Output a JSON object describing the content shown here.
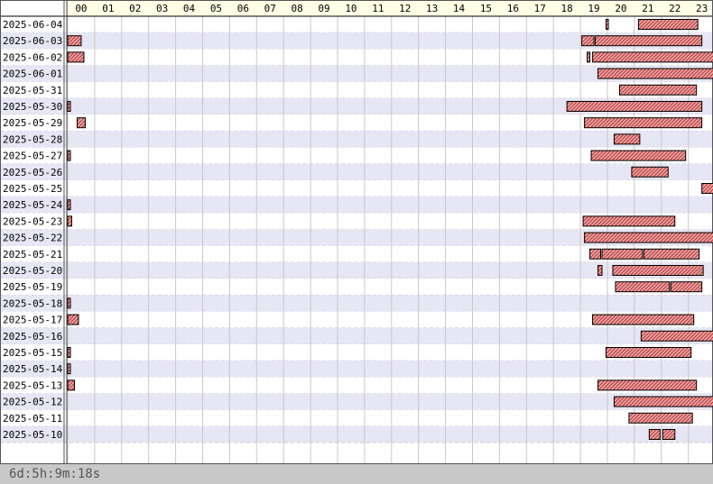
{
  "chart_data": {
    "type": "gantt",
    "x_axis": {
      "unit": "hour",
      "ticks": [
        "00",
        "01",
        "02",
        "03",
        "04",
        "05",
        "06",
        "07",
        "08",
        "09",
        "10",
        "11",
        "12",
        "13",
        "14",
        "15",
        "16",
        "17",
        "18",
        "19",
        "20",
        "21",
        "22",
        "23"
      ],
      "range": [
        0,
        24
      ]
    },
    "rows": [
      {
        "date": "2025-06-04",
        "intervals": [
          [
            19.95,
            20.0
          ],
          [
            21.15,
            23.35
          ]
        ]
      },
      {
        "date": "2025-06-03",
        "intervals": [
          [
            0.0,
            0.5
          ],
          [
            19.05,
            19.5
          ],
          [
            19.55,
            23.5
          ]
        ]
      },
      {
        "date": "2025-06-02",
        "intervals": [
          [
            0.0,
            0.6
          ],
          [
            19.25,
            19.35
          ],
          [
            19.45,
            23.95
          ]
        ]
      },
      {
        "date": "2025-06-01",
        "intervals": [
          [
            19.65,
            23.95
          ]
        ]
      },
      {
        "date": "2025-05-31",
        "intervals": [
          [
            20.45,
            23.3
          ]
        ]
      },
      {
        "date": "2025-05-30",
        "intervals": [
          [
            0.0,
            0.1
          ],
          [
            18.5,
            23.5
          ]
        ]
      },
      {
        "date": "2025-05-29",
        "intervals": [
          [
            0.35,
            0.65
          ],
          [
            19.15,
            23.5
          ]
        ]
      },
      {
        "date": "2025-05-28",
        "intervals": [
          [
            20.25,
            21.2
          ]
        ]
      },
      {
        "date": "2025-05-27",
        "intervals": [
          [
            0.0,
            0.1
          ],
          [
            19.4,
            22.9
          ]
        ]
      },
      {
        "date": "2025-05-26",
        "intervals": [
          [
            20.9,
            22.25
          ]
        ]
      },
      {
        "date": "2025-05-25",
        "intervals": [
          [
            23.5,
            23.95
          ]
        ]
      },
      {
        "date": "2025-05-24",
        "intervals": [
          [
            0.0,
            0.1
          ]
        ]
      },
      {
        "date": "2025-05-23",
        "intervals": [
          [
            0.0,
            0.15
          ],
          [
            19.1,
            22.5
          ]
        ]
      },
      {
        "date": "2025-05-22",
        "intervals": [
          [
            19.15,
            23.95
          ]
        ]
      },
      {
        "date": "2025-05-21",
        "intervals": [
          [
            19.35,
            19.75
          ],
          [
            19.8,
            21.3
          ],
          [
            21.35,
            23.4
          ]
        ]
      },
      {
        "date": "2025-05-20",
        "intervals": [
          [
            19.65,
            19.8
          ],
          [
            20.2,
            23.55
          ]
        ]
      },
      {
        "date": "2025-05-19",
        "intervals": [
          [
            20.3,
            22.3
          ],
          [
            22.35,
            23.5
          ]
        ]
      },
      {
        "date": "2025-05-18",
        "intervals": [
          [
            0.0,
            0.1
          ]
        ]
      },
      {
        "date": "2025-05-17",
        "intervals": [
          [
            0.0,
            0.4
          ],
          [
            19.45,
            23.2
          ]
        ]
      },
      {
        "date": "2025-05-16",
        "intervals": [
          [
            21.25,
            23.95
          ]
        ]
      },
      {
        "date": "2025-05-15",
        "intervals": [
          [
            0.0,
            0.1
          ],
          [
            19.95,
            23.1
          ]
        ]
      },
      {
        "date": "2025-05-14",
        "intervals": [
          [
            0.0,
            0.1
          ]
        ]
      },
      {
        "date": "2025-05-13",
        "intervals": [
          [
            0.0,
            0.25
          ],
          [
            19.65,
            23.3
          ]
        ]
      },
      {
        "date": "2025-05-12",
        "intervals": [
          [
            20.25,
            23.95
          ]
        ]
      },
      {
        "date": "2025-05-11",
        "intervals": [
          [
            20.8,
            23.15
          ]
        ]
      },
      {
        "date": "2025-05-10",
        "intervals": [
          [
            21.55,
            21.95
          ],
          [
            22.05,
            22.5
          ]
        ]
      }
    ],
    "colors": {
      "bar_fill": "#f2a6a6",
      "bar_hatch": "#a83232",
      "bar_stroke": "#000000",
      "row_alt": "#e6e6f4",
      "header_bg": "#ffffe6",
      "grid": "#c8c8c8"
    }
  },
  "status_text": "6d:5h:9m:18s"
}
